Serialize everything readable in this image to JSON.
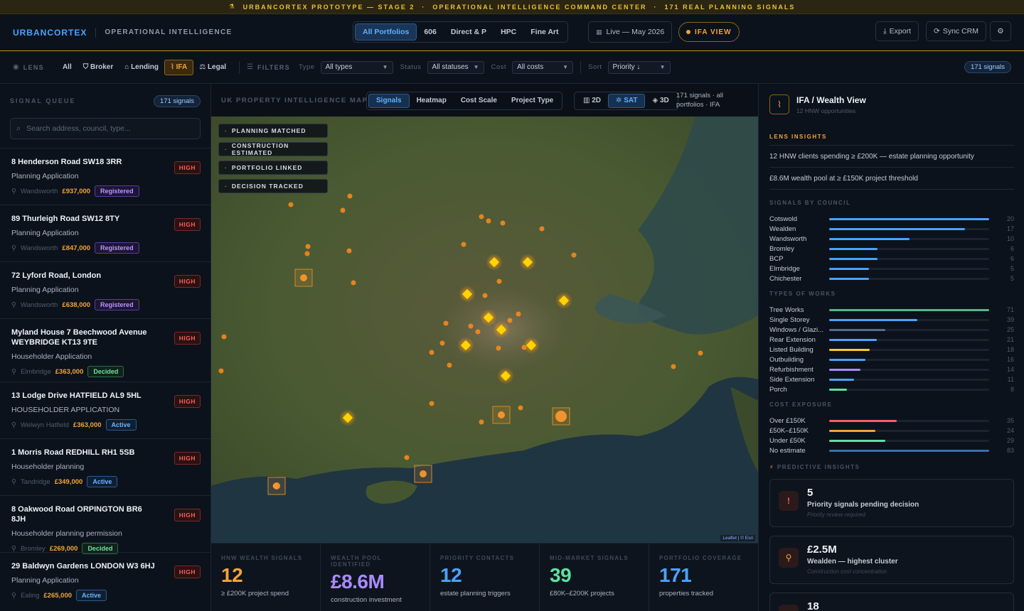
{
  "banner": {
    "items": [
      "URBANCORTEX PROTOTYPE — STAGE 2",
      "OPERATIONAL INTELLIGENCE COMMAND CENTER",
      "171 REAL PLANNING SIGNALS"
    ]
  },
  "header": {
    "brand": "URBANCORTEX",
    "subtitle": "OPERATIONAL INTELLIGENCE",
    "portfolios": [
      "All Portfolios",
      "606",
      "Direct & P",
      "HPC",
      "Fine Art"
    ],
    "live": "Live — May 2026",
    "ifa_view": "IFA VIEW",
    "export": "Export",
    "sync": "Sync CRM"
  },
  "lensbar": {
    "lens_label": "LENS",
    "lenses": [
      "All",
      "Broker",
      "Lending",
      "IFA",
      "Legal"
    ],
    "filters_label": "FILTERS",
    "type_label": "Type",
    "type_value": "All types",
    "status_label": "Status",
    "status_value": "All statuses",
    "cost_label": "Cost",
    "cost_value": "All costs",
    "sort_label": "Sort",
    "sort_value": "Priority ↓",
    "signals_pill": "171 signals"
  },
  "queue": {
    "title": "SIGNAL QUEUE",
    "count": "171 signals",
    "search_placeholder": "Search address, council, type...",
    "items": [
      {
        "address": "8 Henderson Road SW18 3RR",
        "type": "Planning Application",
        "council": "Wandsworth",
        "cost": "£937,000",
        "status": "Registered",
        "priority": "HIGH"
      },
      {
        "address": "89 Thurleigh Road SW12 8TY",
        "type": "Planning Application",
        "council": "Wandsworth",
        "cost": "£847,000",
        "status": "Registered",
        "priority": "HIGH"
      },
      {
        "address": "72 Lyford Road, London",
        "type": "Planning Application",
        "council": "Wandsworth",
        "cost": "£638,000",
        "status": "Registered",
        "priority": "HIGH"
      },
      {
        "address": "Myland House 7 Beechwood Avenue WEYBRIDGE KT13 9TE",
        "type": "Householder Application",
        "council": "Elmbridge",
        "cost": "£363,000",
        "status": "Decided",
        "priority": "HIGH"
      },
      {
        "address": "13 Lodge Drive HATFIELD AL9 5HL",
        "type": "HOUSEHOLDER APPLICATION",
        "council": "Welwyn Hatfield",
        "cost": "£363,000",
        "status": "Active",
        "priority": "HIGH"
      },
      {
        "address": "1 Morris Road REDHILL RH1 5SB",
        "type": "Householder planning",
        "council": "Tandridge",
        "cost": "£349,000",
        "status": "Active",
        "priority": "HIGH"
      },
      {
        "address": "8 Oakwood Road ORPINGTON BR6 8JH",
        "type": "Householder planning permission",
        "council": "Bromley",
        "cost": "£269,000",
        "status": "Decided",
        "priority": "HIGH"
      },
      {
        "address": "29 Baldwyn Gardens LONDON W3 6HJ",
        "type": "Planning Application",
        "council": "Ealing",
        "cost": "£265,000",
        "status": "Active",
        "priority": "HIGH"
      }
    ]
  },
  "map": {
    "title": "UK PROPERTY INTELLIGENCE MAP",
    "tabs": [
      "Signals",
      "Heatmap",
      "Cost Scale",
      "Project Type"
    ],
    "views": [
      "2D",
      "SAT",
      "3D"
    ],
    "summary_line1": "171 signals · all",
    "summary_line2": "portfolios · IFA",
    "legend": [
      "PLANNING MATCHED",
      "CONSTRUCTION ESTIMATED",
      "PORTFOLIO LINKED",
      "DECISION TRACKED"
    ],
    "attribution": "Leaflet | © Esri"
  },
  "kpis": [
    {
      "label": "HNW WEALTH SIGNALS",
      "value": "12",
      "sub": "≥ £200K project spend",
      "color": "#f3a33a"
    },
    {
      "label": "WEALTH POOL IDENTIFIED",
      "value": "£8.6M",
      "sub": "construction investment",
      "color": "#a98bff"
    },
    {
      "label": "PRIORITY CONTACTS",
      "value": "12",
      "sub": "estate planning triggers",
      "color": "#4aa3ff"
    },
    {
      "label": "MID-MARKET SIGNALS",
      "value": "39",
      "sub": "£80K–£200K projects",
      "color": "#5fe0a0"
    },
    {
      "label": "PORTFOLIO COVERAGE",
      "value": "171",
      "sub": "properties tracked",
      "color": "#4aa3ff"
    }
  ],
  "right": {
    "title": "IFA / Wealth View",
    "subtitle": "12 HNW opportunities",
    "lens_insights_title": "LENS INSIGHTS",
    "insights": [
      "12 HNW clients spending ≥ £200K — estate planning opportunity",
      "£8.6M wealth pool at ≥ £150K project threshold"
    ],
    "council_title": "SIGNALS BY COUNCIL",
    "councils": [
      {
        "name": "Cotswold",
        "value": 20,
        "color": "#4aa3ff"
      },
      {
        "name": "Wealden",
        "value": 17,
        "color": "#4aa3ff"
      },
      {
        "name": "Wandsworth",
        "value": 10,
        "color": "#4aa3ff"
      },
      {
        "name": "Bromley",
        "value": 6,
        "color": "#4aa3ff"
      },
      {
        "name": "BCP",
        "value": 6,
        "color": "#4aa3ff"
      },
      {
        "name": "Elmbridge",
        "value": 5,
        "color": "#4aa3ff"
      },
      {
        "name": "Chichester",
        "value": 5,
        "color": "#4aa3ff"
      }
    ],
    "works_title": "TYPES OF WORKS",
    "works": [
      {
        "name": "Tree Works",
        "value": 71,
        "color": "#5ab58a"
      },
      {
        "name": "Single Storey",
        "value": 39,
        "color": "#4aa3ff"
      },
      {
        "name": "Windows / Glazi...",
        "value": 25,
        "color": "#5a6b8a"
      },
      {
        "name": "Rear Extension",
        "value": 21,
        "color": "#4aa3ff"
      },
      {
        "name": "Listed Building",
        "value": 18,
        "color": "#f3d02a"
      },
      {
        "name": "Outbuilding",
        "value": 16,
        "color": "#4aa3ff"
      },
      {
        "name": "Refurbishment",
        "value": 14,
        "color": "#a98bff"
      },
      {
        "name": "Side Extension",
        "value": 11,
        "color": "#4aa3ff"
      },
      {
        "name": "Porch",
        "value": 8,
        "color": "#5fe0a0"
      }
    ],
    "cost_title": "COST EXPOSURE",
    "costs": [
      {
        "name": "Over £150K",
        "value": 35,
        "color": "#ff5a6a"
      },
      {
        "name": "£50K–£150K",
        "value": 24,
        "color": "#f3a33a"
      },
      {
        "name": "Under £50K",
        "value": 29,
        "color": "#5fe0a0"
      },
      {
        "name": "No estimate",
        "value": 83,
        "color": "#3b6ea8"
      }
    ],
    "predictive_title": "PREDICTIVE INSIGHTS",
    "predictive": [
      {
        "value": "5",
        "title": "Priority signals pending decision",
        "note": "Priority review required",
        "icon": "alert-icon"
      },
      {
        "value": "£2.5M",
        "title": "Wealden — highest cluster",
        "note": "Construction cost concentration",
        "icon": "pin-icon"
      },
      {
        "value": "18",
        "title": "",
        "note": "",
        "icon": "building-icon"
      }
    ]
  }
}
